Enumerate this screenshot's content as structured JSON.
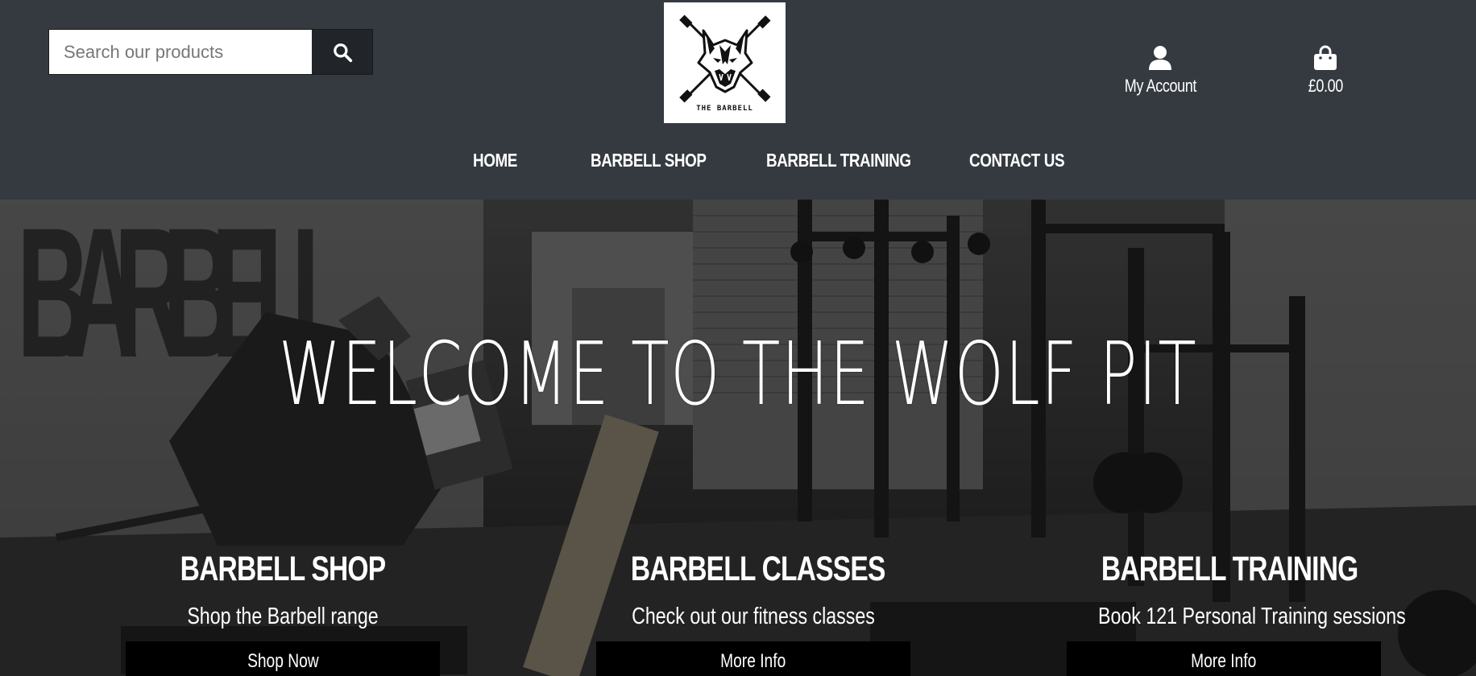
{
  "header": {
    "search": {
      "placeholder": "Search our products",
      "button_icon": "search-icon"
    },
    "logo": {
      "text": "THE BARBELL",
      "icon": "wolf-logo-icon"
    },
    "account": {
      "label": "My Account",
      "icon": "user-icon"
    },
    "cart": {
      "total": "£0.00",
      "icon": "shopping-bag-icon"
    }
  },
  "nav": {
    "items": [
      {
        "label": "HOME"
      },
      {
        "label": "BARBELL SHOP"
      },
      {
        "label": "BARBELL TRAINING"
      },
      {
        "label": "CONTACT US"
      }
    ]
  },
  "hero": {
    "title": "WELCOME TO THE WOLF PIT",
    "features": [
      {
        "title": "BARBELL SHOP",
        "description": "Shop the Barbell range",
        "button": "Shop Now"
      },
      {
        "title": "BARBELL CLASSES",
        "description": "Check out our fitness classes",
        "button": "More Info"
      },
      {
        "title": "BARBELL TRAINING",
        "description": "Book 121 Personal Training sessions",
        "button": "More Info"
      }
    ]
  },
  "colors": {
    "header_bg": "#343a40",
    "search_button_bg": "#212529",
    "text": "#ffffff",
    "button_bg": "#000000"
  }
}
